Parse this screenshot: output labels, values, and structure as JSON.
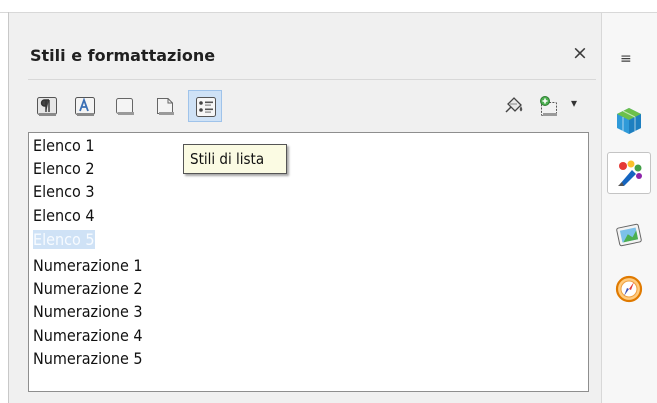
{
  "panel": {
    "title": "Stili e formattazione",
    "close_glyph": "×"
  },
  "toolbar": {
    "buttons": [
      {
        "name": "paragraph-styles",
        "icon": "paragraph-styles-icon"
      },
      {
        "name": "character-styles",
        "icon": "character-styles-icon"
      },
      {
        "name": "frame-styles",
        "icon": "frame-styles-icon"
      },
      {
        "name": "page-styles",
        "icon": "page-styles-icon"
      },
      {
        "name": "list-styles",
        "icon": "list-styles-icon",
        "active": true
      }
    ],
    "fill_format_icon": "paint-bucket-icon",
    "new_style_icon": "new-style-from-selection-icon",
    "dropdown_glyph": "▾"
  },
  "tooltip": {
    "text": "Stili di lista"
  },
  "list": {
    "items": [
      "Elenco 1",
      "Elenco 2",
      "Elenco 3",
      "Elenco 4",
      "Elenco 5",
      "Numerazione 1",
      "Numerazione 2",
      "Numerazione 3",
      "Numerazione 4",
      "Numerazione 5"
    ],
    "selected_index": 4
  },
  "sidebar": {
    "menu_glyph": "≡",
    "buttons": [
      {
        "name": "properties",
        "icon": "cube-properties-icon"
      },
      {
        "name": "styles",
        "icon": "styles-brush-icon",
        "active": true
      },
      {
        "name": "gallery",
        "icon": "gallery-picture-icon"
      },
      {
        "name": "navigator",
        "icon": "navigator-compass-icon"
      }
    ]
  },
  "colors": {
    "selection": "#cfe2f6",
    "tooltip_bg": "#fbfbe3",
    "panel_bg": "#f0f0f0"
  }
}
